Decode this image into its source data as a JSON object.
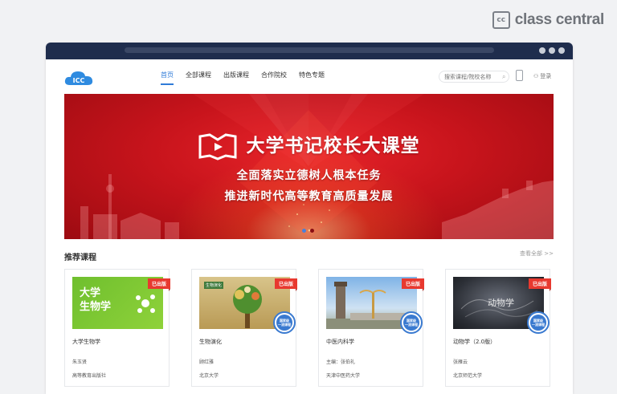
{
  "watermark": {
    "badge": "cc",
    "text": "class central"
  },
  "nav": {
    "logo_text": "ICC",
    "menu": [
      {
        "label": "首页",
        "active": true
      },
      {
        "label": "全部课程",
        "active": false
      },
      {
        "label": "出版课程",
        "active": false
      },
      {
        "label": "合作院校",
        "active": false
      },
      {
        "label": "特色专题",
        "active": false
      }
    ],
    "search_placeholder": "搜索课程/院校名称",
    "login_label": "登录"
  },
  "banner": {
    "title": "大学书记校长大课堂",
    "line1": "全面落实立德树人根本任务",
    "line2": "推进新时代高等教育高质量发展",
    "active_slide": 1,
    "slide_count": 2
  },
  "section": {
    "title": "推荐课程",
    "view_all": "查看全部 >>"
  },
  "courses": [
    {
      "cover_text": "大学\n生物学",
      "badge": "已出版",
      "title": "大学生物学",
      "author": "朱玉贤",
      "publisher": "高等教育出版社",
      "seal": false
    },
    {
      "cover_text": "生物演化",
      "badge": "已出版",
      "title": "生物演化",
      "author": "顾红雅",
      "publisher": "北京大学",
      "seal": true,
      "seal_text": "国家级\n一流课程"
    },
    {
      "cover_text": "",
      "badge": "已出版",
      "title": "中医内科学",
      "author": "主编：张伯礼",
      "publisher": "天津中医药大学",
      "seal": true,
      "seal_text": "国家级\n一流课程"
    },
    {
      "cover_text": "动物学",
      "badge": "已出版",
      "title": "动物学（2.0版）",
      "author": "张雁云",
      "publisher": "北京师范大学",
      "seal": true,
      "seal_text": "国家级\n一流课程"
    }
  ],
  "colors": {
    "accent": "#2f7bd8",
    "header": "#1f2d4d",
    "badge": "#e8392f",
    "banner": "#c8141c"
  }
}
